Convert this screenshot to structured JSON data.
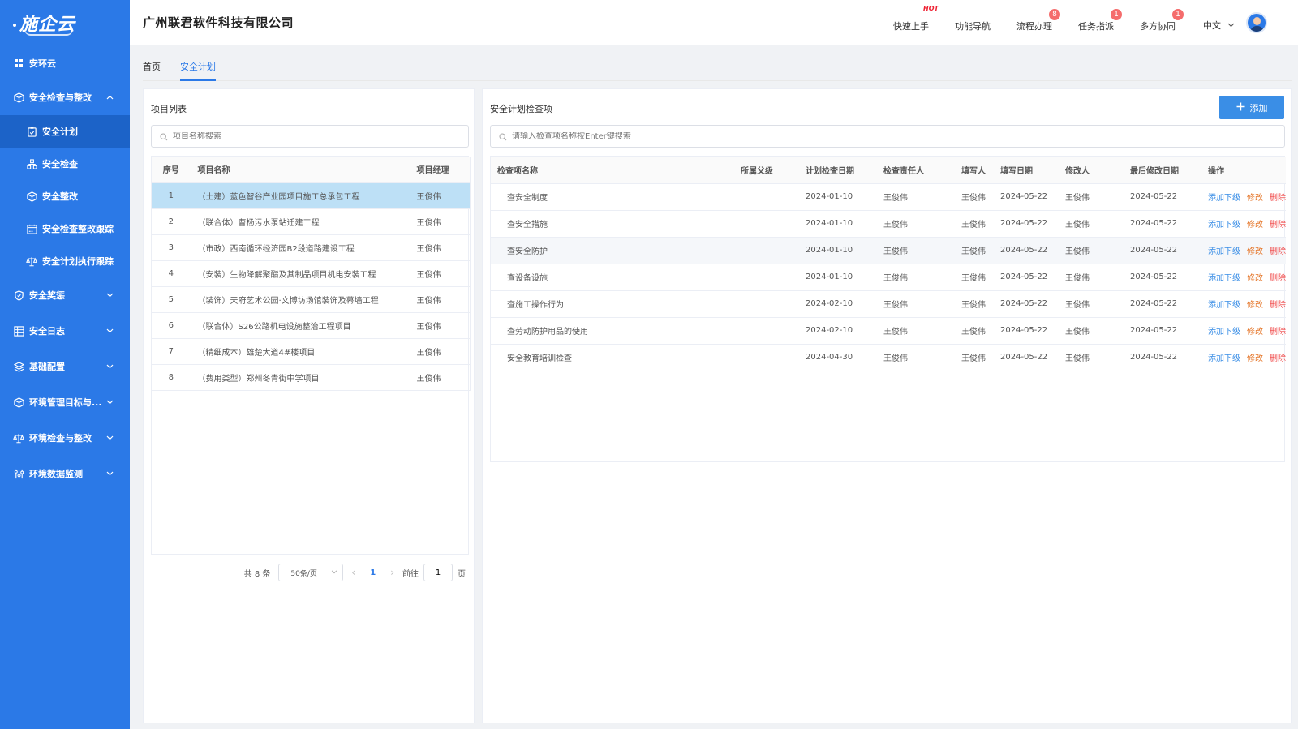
{
  "app": {
    "logo": "施企云",
    "company": "广州联君软件科技有限公司"
  },
  "sidebar": {
    "top": {
      "label": "安环云",
      "icon": "grid-icon"
    },
    "groups": [
      {
        "label": "安全检查与整改",
        "icon": "cube-icon",
        "expanded": true
      },
      {
        "label": "安全奖惩",
        "icon": "shield-icon"
      },
      {
        "label": "安全日志",
        "icon": "calendar-icon"
      },
      {
        "label": "基础配置",
        "icon": "layers-icon"
      },
      {
        "label": "环境管理目标与...",
        "icon": "cube-icon"
      },
      {
        "label": "环境检查与整改",
        "icon": "scale-icon"
      },
      {
        "label": "环境数据监测",
        "icon": "sliders-icon"
      }
    ],
    "subitems": [
      {
        "label": "安全计划",
        "icon": "clipboard-icon",
        "active": true
      },
      {
        "label": "安全检查",
        "icon": "network-icon"
      },
      {
        "label": "安全整改",
        "icon": "cube-icon"
      },
      {
        "label": "安全检查整改跟踪",
        "icon": "calendar-icon"
      },
      {
        "label": "安全计划执行跟踪",
        "icon": "scale-icon"
      }
    ]
  },
  "header": {
    "nav": [
      {
        "label": "快速上手",
        "hot": "HOT"
      },
      {
        "label": "功能导航"
      },
      {
        "label": "流程办理",
        "badge": "8"
      },
      {
        "label": "任务指派",
        "badge": "1"
      },
      {
        "label": "多方协同",
        "badge": "1"
      }
    ],
    "lang": "中文"
  },
  "tabs": [
    {
      "label": "首页",
      "active": false
    },
    {
      "label": "安全计划",
      "active": true
    }
  ],
  "left": {
    "title": "项目列表",
    "search_placeholder": "项目名称搜索",
    "columns": [
      "序号",
      "项目名称",
      "项目经理"
    ],
    "rows": [
      [
        "1",
        "（土建）蓝色智谷产业园项目施工总承包工程",
        "王俊伟"
      ],
      [
        "2",
        "（联合体）曹杨污水泵站迁建工程",
        "王俊伟"
      ],
      [
        "3",
        "（市政）西南循环经济园B2段道路建设工程",
        "王俊伟"
      ],
      [
        "4",
        "（安装）生物降解聚酯及其制品项目机电安装工程",
        "王俊伟"
      ],
      [
        "5",
        "（装饰）天府艺术公园·文博坊场馆装饰及幕墙工程",
        "王俊伟"
      ],
      [
        "6",
        "（联合体）S26公路机电设施整治工程项目",
        "王俊伟"
      ],
      [
        "7",
        "（精细成本）雄楚大道4#楼项目",
        "王俊伟"
      ],
      [
        "8",
        "（费用类型）郑州冬青街中学项目",
        "王俊伟"
      ]
    ],
    "selected_row": 0,
    "pager": {
      "total": "共 8 条",
      "size": "50条/页",
      "page": "1",
      "goto_prefix": "前往",
      "goto_value": "1",
      "goto_suffix": "页"
    }
  },
  "right": {
    "title": "安全计划检查项",
    "add_label": "添加",
    "search_placeholder": "请输入检查项名称按Enter键搜索",
    "columns": [
      "检查项名称",
      "所属父级",
      "计划检查日期",
      "检查责任人",
      "填写人",
      "填写日期",
      "修改人",
      "最后修改日期",
      "操作"
    ],
    "rows": [
      [
        "查安全制度",
        "",
        "2024-01-10",
        "王俊伟",
        "王俊伟",
        "2024-05-22",
        "王俊伟",
        "2024-05-22"
      ],
      [
        "查安全措施",
        "",
        "2024-01-10",
        "王俊伟",
        "王俊伟",
        "2024-05-22",
        "王俊伟",
        "2024-05-22"
      ],
      [
        "查安全防护",
        "",
        "2024-01-10",
        "王俊伟",
        "王俊伟",
        "2024-05-22",
        "王俊伟",
        "2024-05-22"
      ],
      [
        "查设备设施",
        "",
        "2024-01-10",
        "王俊伟",
        "王俊伟",
        "2024-05-22",
        "王俊伟",
        "2024-05-22"
      ],
      [
        "查施工操作行为",
        "",
        "2024-02-10",
        "王俊伟",
        "王俊伟",
        "2024-05-22",
        "王俊伟",
        "2024-05-22"
      ],
      [
        "查劳动防护用品的使用",
        "",
        "2024-02-10",
        "王俊伟",
        "王俊伟",
        "2024-05-22",
        "王俊伟",
        "2024-05-22"
      ],
      [
        "安全教育培训检查",
        "",
        "2024-04-30",
        "王俊伟",
        "王俊伟",
        "2024-05-22",
        "王俊伟",
        "2024-05-22"
      ]
    ],
    "hover_row": 2,
    "ops": {
      "add_child": "添加下级",
      "edit": "修改",
      "delete": "删除"
    }
  },
  "colors": {
    "sidebar": "#2b79e7",
    "primary": "#3a8ee6",
    "edit": "#e6792e",
    "delete": "#f04848",
    "badge": "#f56c6c"
  }
}
